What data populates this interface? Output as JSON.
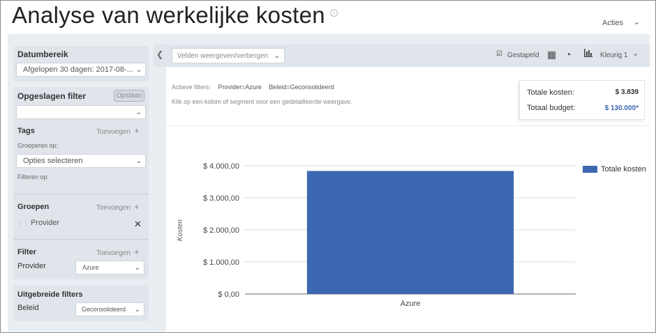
{
  "header": {
    "title": "Analyse van werkelijke kosten",
    "info_icon": "info-icon",
    "actions_label": "Acties"
  },
  "sidebar": {
    "date_range": {
      "title": "Datumbereik",
      "value": "Afgelopen 30 dagen: 2017-08-..."
    },
    "saved_filters": {
      "title": "Opgeslagen filter",
      "save_label": "Opslaan",
      "value": ""
    },
    "tags": {
      "title": "Tags",
      "add_label": "Toevoegen",
      "group_by_label": "Groeperen op:",
      "options_placeholder": "Opties selecteren",
      "filter_by_label": "Filteren op:"
    },
    "groups": {
      "title": "Groepen",
      "add_label": "Toevoegen",
      "item": "Provider"
    },
    "filter": {
      "title": "Filter",
      "add_label": "Toevoegen",
      "field": "Provider",
      "value": "Azure"
    },
    "advanced": {
      "title": "Uitgebreide filters",
      "field": "Beleid",
      "value": "Geconsolideerd"
    }
  },
  "toolbar": {
    "fields_button": "Velden weergeven/verbergen",
    "stacked_label": "Gestapeld",
    "color_label": "Kleurig 1"
  },
  "filters": {
    "active_label": "Actieve filters:",
    "items": [
      "Provider=Azure",
      "Beleid=Geconsolideerd"
    ],
    "hint": "Klik op een kolom of segment voor een gedetailleerde weergave."
  },
  "summary": {
    "total_cost_label": "Totale kosten:",
    "total_cost_value": "$ 3.839",
    "total_budget_label": "Totaal budget:",
    "total_budget_value": "$ 130.000*"
  },
  "colors": {
    "bar": "#3e67b1",
    "budget_value": "#3e67b1",
    "panel_bg": "#dfe5ea"
  },
  "chart_data": {
    "type": "bar",
    "categories": [
      "Azure"
    ],
    "series": [
      {
        "name": "Totale kosten",
        "values": [
          3839
        ]
      }
    ],
    "ylabel": "Kosten",
    "ylim": [
      0,
      4000
    ],
    "yticks": [
      "$ 0,00",
      "$ 1.000,00",
      "$ 2.000,00",
      "$ 3.000,00",
      "$ 4.000,00"
    ],
    "ytick_values": [
      0,
      1000,
      2000,
      3000,
      4000
    ],
    "legend": "top-right",
    "grid": true
  }
}
